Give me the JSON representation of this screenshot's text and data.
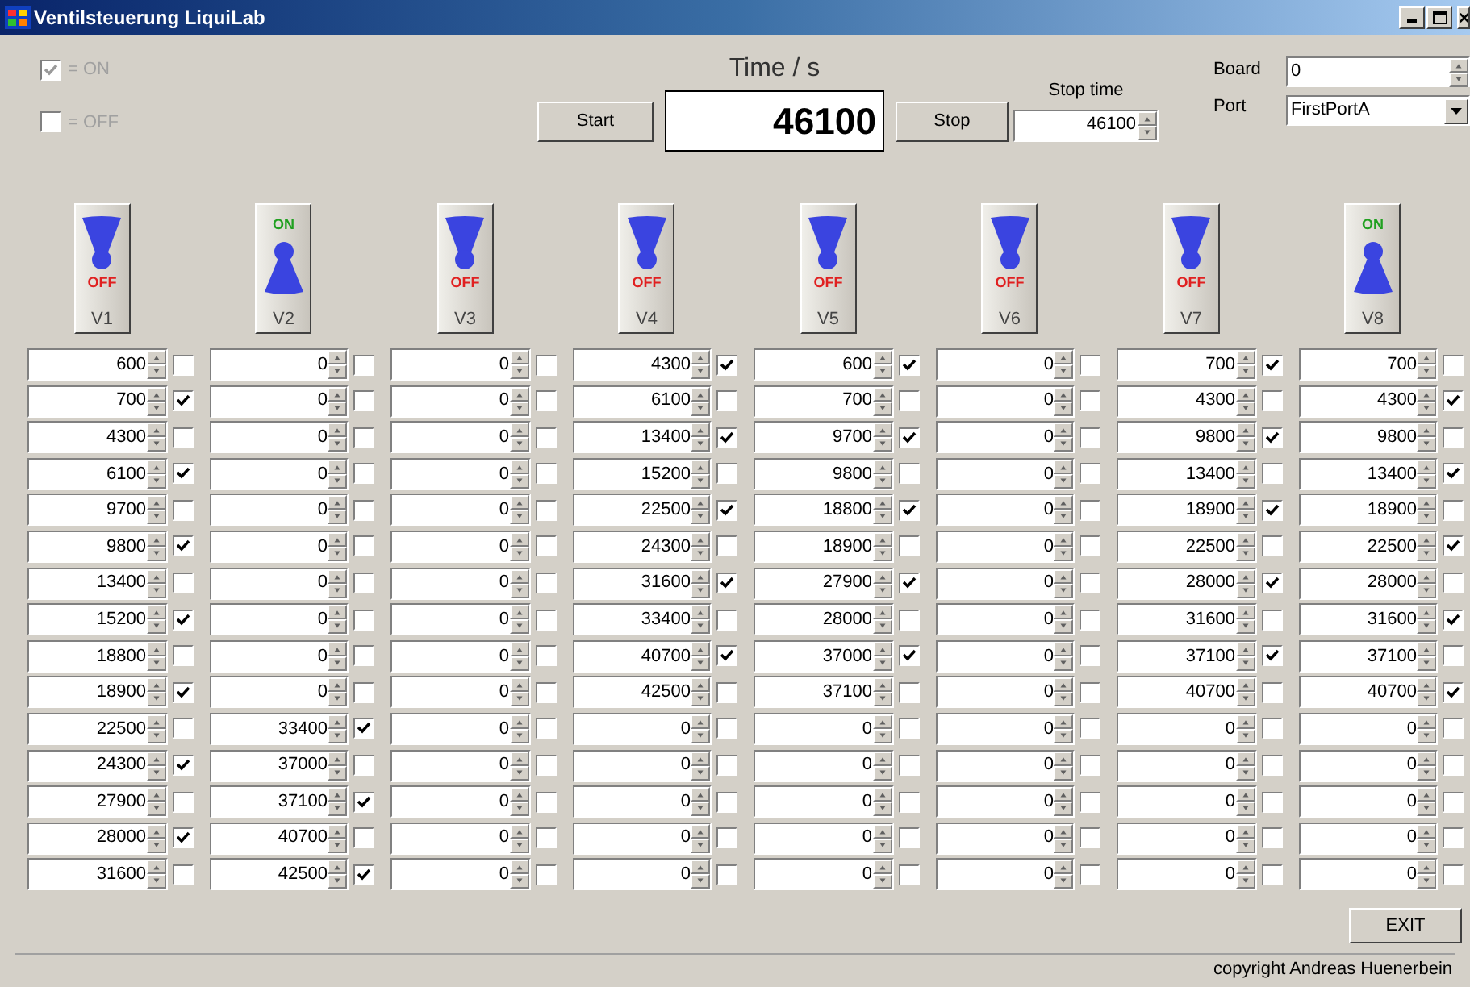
{
  "window": {
    "title": "Ventilsteuerung LiquiLab"
  },
  "legend": [
    {
      "label": "= ON",
      "checked": true
    },
    {
      "label": "= OFF",
      "checked": false
    }
  ],
  "timer": {
    "title": "Time / s",
    "value": "46100"
  },
  "buttons": {
    "start": "Start",
    "stop": "Stop",
    "exit": "EXIT"
  },
  "stop_time": {
    "label": "Stop time",
    "value": "46100"
  },
  "board": {
    "label": "Board",
    "value": "0"
  },
  "port": {
    "label": "Port",
    "value": "FirstPortA"
  },
  "valves": [
    {
      "name": "V1",
      "on": false,
      "state_label": "OFF",
      "entries": [
        {
          "value": "600",
          "checked": false
        },
        {
          "value": "700",
          "checked": true
        },
        {
          "value": "4300",
          "checked": false
        },
        {
          "value": "6100",
          "checked": true
        },
        {
          "value": "9700",
          "checked": false
        },
        {
          "value": "9800",
          "checked": true
        },
        {
          "value": "13400",
          "checked": false
        },
        {
          "value": "15200",
          "checked": true
        },
        {
          "value": "18800",
          "checked": false
        },
        {
          "value": "18900",
          "checked": true
        },
        {
          "value": "22500",
          "checked": false
        },
        {
          "value": "24300",
          "checked": true
        },
        {
          "value": "27900",
          "checked": false
        },
        {
          "value": "28000",
          "checked": true
        },
        {
          "value": "31600",
          "checked": false
        }
      ]
    },
    {
      "name": "V2",
      "on": true,
      "state_label": "ON",
      "entries": [
        {
          "value": "0",
          "checked": false
        },
        {
          "value": "0",
          "checked": false
        },
        {
          "value": "0",
          "checked": false
        },
        {
          "value": "0",
          "checked": false
        },
        {
          "value": "0",
          "checked": false
        },
        {
          "value": "0",
          "checked": false
        },
        {
          "value": "0",
          "checked": false
        },
        {
          "value": "0",
          "checked": false
        },
        {
          "value": "0",
          "checked": false
        },
        {
          "value": "0",
          "checked": false
        },
        {
          "value": "33400",
          "checked": true
        },
        {
          "value": "37000",
          "checked": false
        },
        {
          "value": "37100",
          "checked": true
        },
        {
          "value": "40700",
          "checked": false
        },
        {
          "value": "42500",
          "checked": true
        }
      ]
    },
    {
      "name": "V3",
      "on": false,
      "state_label": "OFF",
      "entries": [
        {
          "value": "0",
          "checked": false
        },
        {
          "value": "0",
          "checked": false
        },
        {
          "value": "0",
          "checked": false
        },
        {
          "value": "0",
          "checked": false
        },
        {
          "value": "0",
          "checked": false
        },
        {
          "value": "0",
          "checked": false
        },
        {
          "value": "0",
          "checked": false
        },
        {
          "value": "0",
          "checked": false
        },
        {
          "value": "0",
          "checked": false
        },
        {
          "value": "0",
          "checked": false
        },
        {
          "value": "0",
          "checked": false
        },
        {
          "value": "0",
          "checked": false
        },
        {
          "value": "0",
          "checked": false
        },
        {
          "value": "0",
          "checked": false
        },
        {
          "value": "0",
          "checked": false
        }
      ]
    },
    {
      "name": "V4",
      "on": false,
      "state_label": "OFF",
      "entries": [
        {
          "value": "4300",
          "checked": true
        },
        {
          "value": "6100",
          "checked": false
        },
        {
          "value": "13400",
          "checked": true
        },
        {
          "value": "15200",
          "checked": false
        },
        {
          "value": "22500",
          "checked": true
        },
        {
          "value": "24300",
          "checked": false
        },
        {
          "value": "31600",
          "checked": true
        },
        {
          "value": "33400",
          "checked": false
        },
        {
          "value": "40700",
          "checked": true
        },
        {
          "value": "42500",
          "checked": false
        },
        {
          "value": "0",
          "checked": false
        },
        {
          "value": "0",
          "checked": false
        },
        {
          "value": "0",
          "checked": false
        },
        {
          "value": "0",
          "checked": false
        },
        {
          "value": "0",
          "checked": false
        }
      ]
    },
    {
      "name": "V5",
      "on": false,
      "state_label": "OFF",
      "entries": [
        {
          "value": "600",
          "checked": true
        },
        {
          "value": "700",
          "checked": false
        },
        {
          "value": "9700",
          "checked": true
        },
        {
          "value": "9800",
          "checked": false
        },
        {
          "value": "18800",
          "checked": true
        },
        {
          "value": "18900",
          "checked": false
        },
        {
          "value": "27900",
          "checked": true
        },
        {
          "value": "28000",
          "checked": false
        },
        {
          "value": "37000",
          "checked": true
        },
        {
          "value": "37100",
          "checked": false
        },
        {
          "value": "0",
          "checked": false
        },
        {
          "value": "0",
          "checked": false
        },
        {
          "value": "0",
          "checked": false
        },
        {
          "value": "0",
          "checked": false
        },
        {
          "value": "0",
          "checked": false
        }
      ]
    },
    {
      "name": "V6",
      "on": false,
      "state_label": "OFF",
      "entries": [
        {
          "value": "0",
          "checked": false
        },
        {
          "value": "0",
          "checked": false
        },
        {
          "value": "0",
          "checked": false
        },
        {
          "value": "0",
          "checked": false
        },
        {
          "value": "0",
          "checked": false
        },
        {
          "value": "0",
          "checked": false
        },
        {
          "value": "0",
          "checked": false
        },
        {
          "value": "0",
          "checked": false
        },
        {
          "value": "0",
          "checked": false
        },
        {
          "value": "0",
          "checked": false
        },
        {
          "value": "0",
          "checked": false
        },
        {
          "value": "0",
          "checked": false
        },
        {
          "value": "0",
          "checked": false
        },
        {
          "value": "0",
          "checked": false
        },
        {
          "value": "0",
          "checked": false
        }
      ]
    },
    {
      "name": "V7",
      "on": false,
      "state_label": "OFF",
      "entries": [
        {
          "value": "700",
          "checked": true
        },
        {
          "value": "4300",
          "checked": false
        },
        {
          "value": "9800",
          "checked": true
        },
        {
          "value": "13400",
          "checked": false
        },
        {
          "value": "18900",
          "checked": true
        },
        {
          "value": "22500",
          "checked": false
        },
        {
          "value": "28000",
          "checked": true
        },
        {
          "value": "31600",
          "checked": false
        },
        {
          "value": "37100",
          "checked": true
        },
        {
          "value": "40700",
          "checked": false
        },
        {
          "value": "0",
          "checked": false
        },
        {
          "value": "0",
          "checked": false
        },
        {
          "value": "0",
          "checked": false
        },
        {
          "value": "0",
          "checked": false
        },
        {
          "value": "0",
          "checked": false
        }
      ]
    },
    {
      "name": "V8",
      "on": true,
      "state_label": "ON",
      "entries": [
        {
          "value": "700",
          "checked": false
        },
        {
          "value": "4300",
          "checked": true
        },
        {
          "value": "9800",
          "checked": false
        },
        {
          "value": "13400",
          "checked": true
        },
        {
          "value": "18900",
          "checked": false
        },
        {
          "value": "22500",
          "checked": true
        },
        {
          "value": "28000",
          "checked": false
        },
        {
          "value": "31600",
          "checked": true
        },
        {
          "value": "37100",
          "checked": false
        },
        {
          "value": "40700",
          "checked": true
        },
        {
          "value": "0",
          "checked": false
        },
        {
          "value": "0",
          "checked": false
        },
        {
          "value": "0",
          "checked": false
        },
        {
          "value": "0",
          "checked": false
        },
        {
          "value": "0",
          "checked": false
        }
      ]
    }
  ],
  "status_bar": {
    "text": "copyright Andreas Huenerbein"
  }
}
